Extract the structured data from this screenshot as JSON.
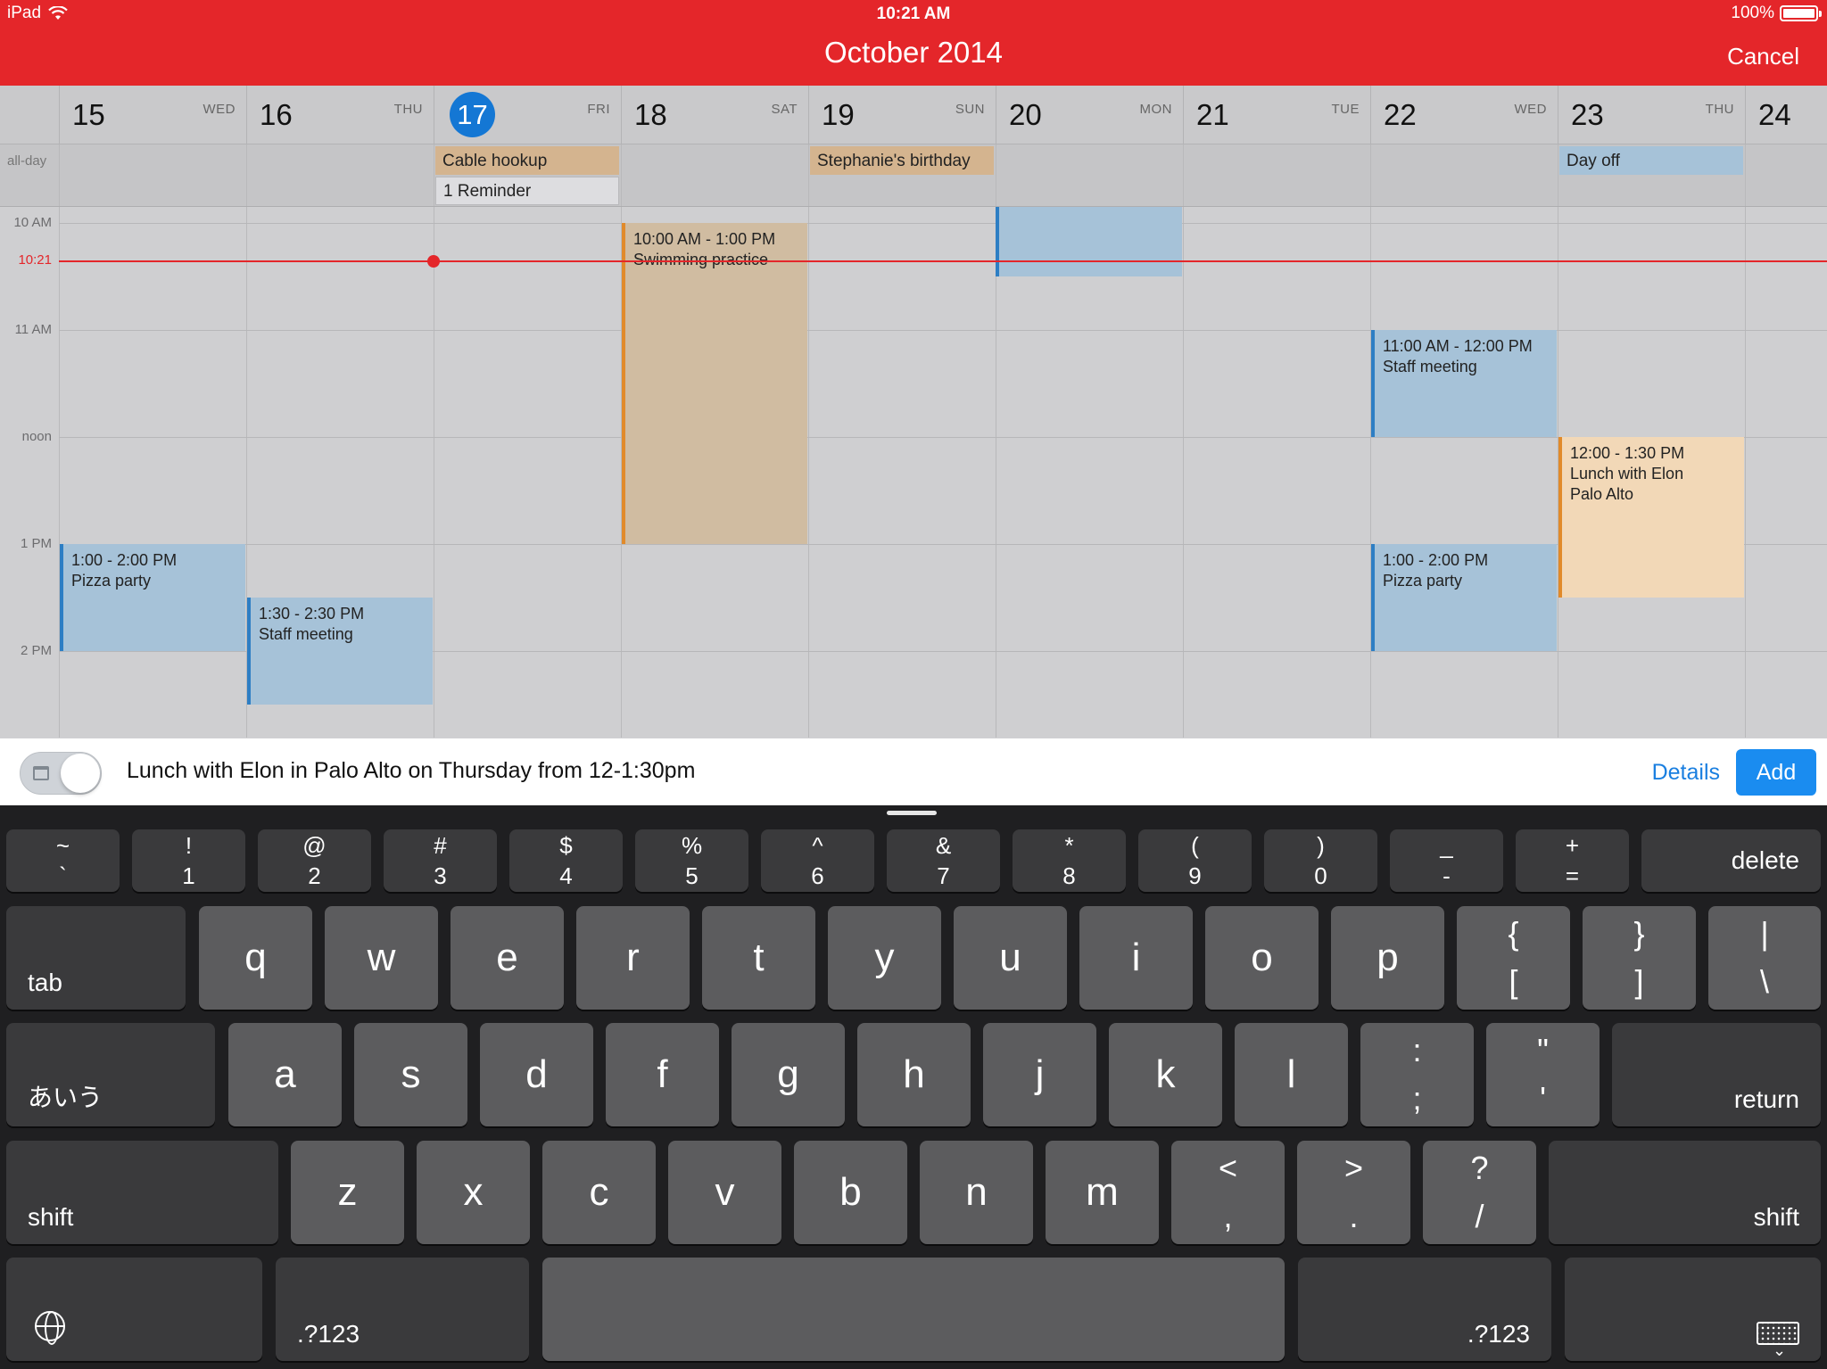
{
  "status_bar": {
    "device": "iPad",
    "time": "10:21 AM",
    "battery": "100%"
  },
  "header": {
    "title": "October 2014",
    "cancel_label": "Cancel"
  },
  "days": [
    {
      "num": "15",
      "name": "WED"
    },
    {
      "num": "16",
      "name": "THU"
    },
    {
      "num": "17",
      "name": "FRI",
      "today": true
    },
    {
      "num": "18",
      "name": "SAT"
    },
    {
      "num": "19",
      "name": "SUN"
    },
    {
      "num": "20",
      "name": "MON"
    },
    {
      "num": "21",
      "name": "TUE"
    },
    {
      "num": "22",
      "name": "WED"
    },
    {
      "num": "23",
      "name": "THU"
    },
    {
      "num": "24",
      "name": ""
    }
  ],
  "allday": {
    "label": "all-day",
    "events": [
      {
        "title": "Cable hookup"
      },
      {
        "title": "1 Reminder"
      },
      {
        "title": "Stephanie's birthday"
      },
      {
        "title": "Day off"
      }
    ]
  },
  "time_labels": {
    "h10": "10 AM",
    "h11": "11 AM",
    "noon": "noon",
    "h13": "1 PM",
    "h14": "2 PM",
    "now": "10:21"
  },
  "events": [
    {
      "time": "10:00 AM - 1:00 PM",
      "title": "Swimming practice"
    },
    {
      "time": "11:00 AM - 12:00 PM",
      "title": "Staff meeting"
    },
    {
      "time": "12:00 - 1:30 PM",
      "title": "Lunch with Elon",
      "location": "Palo Alto"
    },
    {
      "time": "1:00 - 2:00 PM",
      "title": "Pizza party"
    },
    {
      "time": "1:30 - 2:30 PM",
      "title": "Staff meeting"
    },
    {
      "time": "1:00 - 2:00 PM",
      "title": "Pizza party"
    }
  ],
  "quick_add": {
    "text": "Lunch with Elon in Palo Alto on Thursday from 12-1:30pm",
    "details_label": "Details",
    "add_label": "Add"
  },
  "keyboard": {
    "number_row": [
      {
        "top": "~",
        "bot": "`"
      },
      {
        "top": "!",
        "bot": "1"
      },
      {
        "top": "@",
        "bot": "2"
      },
      {
        "top": "#",
        "bot": "3"
      },
      {
        "top": "$",
        "bot": "4"
      },
      {
        "top": "%",
        "bot": "5"
      },
      {
        "top": "^",
        "bot": "6"
      },
      {
        "top": "&",
        "bot": "7"
      },
      {
        "top": "*",
        "bot": "8"
      },
      {
        "top": "(",
        "bot": "9"
      },
      {
        "top": ")",
        "bot": "0"
      },
      {
        "top": "_",
        "bot": "-"
      },
      {
        "top": "+",
        "bot": "="
      }
    ],
    "delete_label": "delete",
    "tab_label": "tab",
    "row1": [
      "q",
      "w",
      "e",
      "r",
      "t",
      "y",
      "u",
      "i",
      "o",
      "p"
    ],
    "row1_extra": [
      {
        "top": "{",
        "bot": "["
      },
      {
        "top": "}",
        "bot": "]"
      },
      {
        "top": "|",
        "bot": "\\"
      }
    ],
    "kana_label": "あいう",
    "row2": [
      "a",
      "s",
      "d",
      "f",
      "g",
      "h",
      "j",
      "k",
      "l"
    ],
    "row2_extra": [
      {
        "top": ":",
        "bot": ";"
      },
      {
        "top": "\"",
        "bot": "'"
      }
    ],
    "return_label": "return",
    "shift_label": "shift",
    "row3": [
      "z",
      "x",
      "c",
      "v",
      "b",
      "n",
      "m"
    ],
    "row3_extra": [
      {
        "top": "<",
        "bot": ","
      },
      {
        "top": ">",
        "bot": "."
      },
      {
        "top": "?",
        "bot": "/"
      }
    ],
    "numbers_label": ".?123"
  }
}
